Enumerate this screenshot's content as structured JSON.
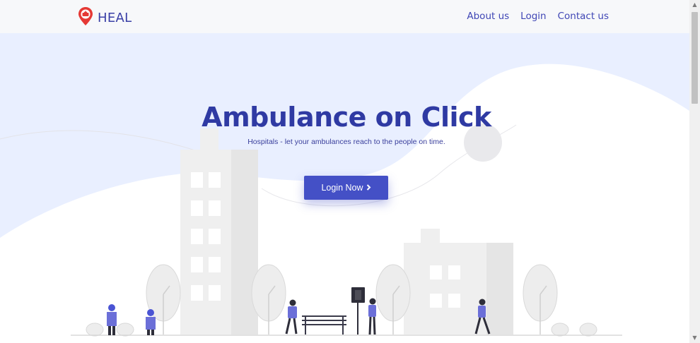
{
  "brand": {
    "name": "HEAL",
    "logo_icon": "ambulance-pin-icon",
    "accent": "#e53935"
  },
  "nav": {
    "links": [
      "About us",
      "Login",
      "Contact us"
    ]
  },
  "hero": {
    "title": "Ambulance on Click",
    "subtitle": "Hospitals - let your ambulances reach to the people on time.",
    "cta_label": "Login Now",
    "cta_icon": "chevron-right-icon"
  },
  "colors": {
    "primary": "#4450c6",
    "title": "#2f3aa3",
    "hero_bg": "#e9efff"
  }
}
